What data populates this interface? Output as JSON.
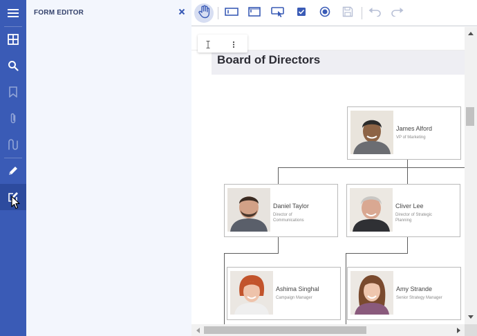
{
  "rail": {
    "items": [
      {
        "icon": "hamburger-menu-icon"
      },
      {
        "icon": "thumbnails-grid-icon"
      },
      {
        "icon": "search-icon"
      },
      {
        "icon": "bookmark-icon"
      },
      {
        "icon": "paperclip-icon"
      },
      {
        "icon": "signature-icon"
      },
      {
        "icon": "pencil-annotate-icon"
      },
      {
        "icon": "form-editor-icon",
        "active": true
      }
    ]
  },
  "panel": {
    "title": "FORM EDITOR"
  },
  "toolbar": {
    "tools": [
      {
        "icon": "pan-hand-icon",
        "active": true
      },
      {
        "icon": "textbox-field-icon"
      },
      {
        "icon": "password-field-icon"
      },
      {
        "icon": "dropdown-field-icon"
      },
      {
        "icon": "checkbox-field-icon"
      },
      {
        "icon": "radio-button-field-icon"
      },
      {
        "icon": "save-icon",
        "disabled": true
      },
      {
        "icon": "undo-icon",
        "disabled": true
      },
      {
        "icon": "redo-icon",
        "disabled": true
      }
    ]
  },
  "document": {
    "title": "Board of Directors",
    "people": [
      {
        "name": "James Alford",
        "role": "VP of Marketing"
      },
      {
        "name": "Daniel Taylor",
        "role": "Director of Communications"
      },
      {
        "name": "Cliver Lee",
        "role": "Director of Strategic Planning"
      },
      {
        "name": "Ashima Singhal",
        "role": "Campaign Manager"
      },
      {
        "name": "Amy Strande",
        "role": "Senior Strategy Manager"
      }
    ]
  },
  "colors": {
    "rail": "#3a5bb6",
    "panel": "#f3f6fd",
    "accent": "#3a5bb6",
    "active_tool_bg": "#d7def2"
  }
}
